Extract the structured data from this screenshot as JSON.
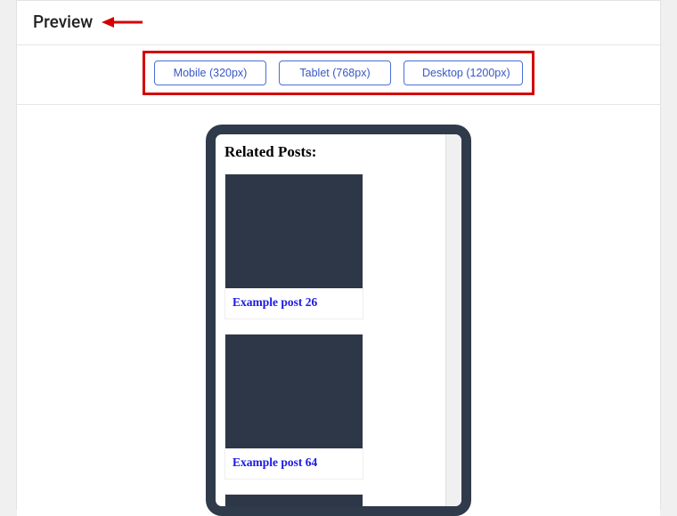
{
  "header": {
    "title": "Preview"
  },
  "viewportButtons": {
    "mobile": "Mobile (320px)",
    "tablet": "Tablet (768px)",
    "desktop": "Desktop (1200px)"
  },
  "previewContent": {
    "heading": "Related Posts:",
    "posts": [
      {
        "title": "Example post 26"
      },
      {
        "title": "Example post 64"
      }
    ]
  }
}
